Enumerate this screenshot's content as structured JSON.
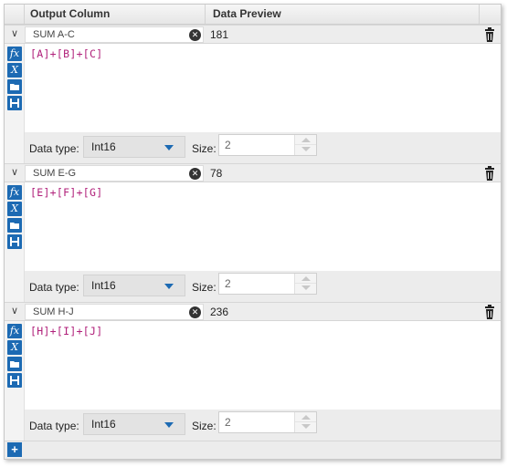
{
  "header": {
    "output_column": "Output Column",
    "data_preview": "Data Preview"
  },
  "expressions": [
    {
      "name": "SUM A-C",
      "preview": "181",
      "expression": "[A]+[B]+[C]",
      "data_type_label": "Data type:",
      "data_type": "Int16",
      "size_label": "Size:",
      "size": "2"
    },
    {
      "name": "SUM E-G",
      "preview": "78",
      "expression": "[E]+[F]+[G]",
      "data_type_label": "Data type:",
      "data_type": "Int16",
      "size_label": "Size:",
      "size": "2"
    },
    {
      "name": "SUM H-J",
      "preview": "236",
      "expression": "[H]+[I]+[J]",
      "data_type_label": "Data type:",
      "data_type": "Int16",
      "size_label": "Size:",
      "size": "2"
    }
  ],
  "icons": {
    "collapse": "chevron-down-icon",
    "clear": "clear-icon",
    "delete": "trash-icon",
    "function": "fx-icon",
    "variable": "variable-icon",
    "open": "folder-open-icon",
    "save": "save-icon",
    "add": "plus-icon"
  },
  "colors": {
    "accent": "#1c6ab3",
    "expression_text": "#b0207a"
  }
}
